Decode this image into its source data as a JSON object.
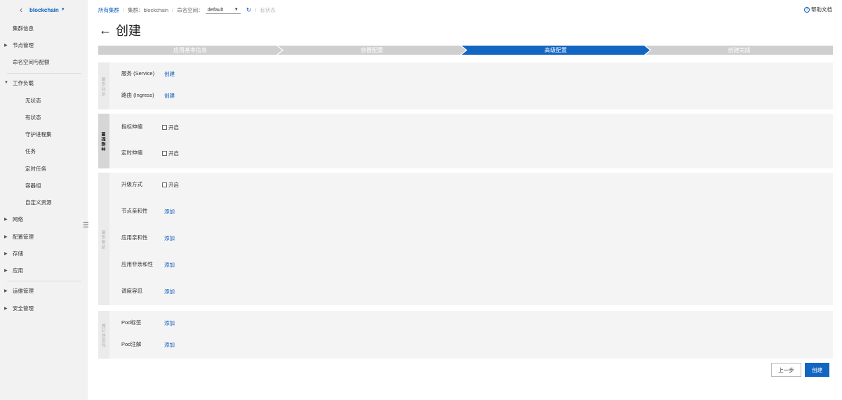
{
  "sidebar": {
    "cluster_name": "blockchain",
    "items": [
      {
        "label": "集群信息"
      },
      {
        "label": "节点管理"
      },
      {
        "label": "命名空间与配额"
      },
      {
        "label": "工作负载"
      },
      {
        "label": "无状态"
      },
      {
        "label": "有状态"
      },
      {
        "label": "守护进程集"
      },
      {
        "label": "任务"
      },
      {
        "label": "定时任务"
      },
      {
        "label": "容器组"
      },
      {
        "label": "自定义资源"
      },
      {
        "label": "网络"
      },
      {
        "label": "配置管理"
      },
      {
        "label": "存储"
      },
      {
        "label": "应用"
      },
      {
        "label": "运维管理"
      },
      {
        "label": "安全管理"
      }
    ]
  },
  "breadcrumb": {
    "all_clusters": "所有集群",
    "cluster": "集群：blockchain",
    "namespace_label": "命名空间：",
    "namespace_value": "default",
    "stateful": "有状态"
  },
  "help": "帮助文档",
  "page_title": "创建",
  "steps": [
    "应用基本信息",
    "容器配置",
    "高级配置",
    "创建完成"
  ],
  "sections": {
    "access": {
      "title": "访问设置",
      "service_label": "服务 (Service)",
      "service_action": "创建",
      "ingress_label": "路由 (Ingress)",
      "ingress_action": "创建"
    },
    "scaling": {
      "title": "伸缩配置",
      "metric_label": "指标伸缩",
      "metric_check": "开启",
      "cron_label": "定时伸缩",
      "cron_check": "开启"
    },
    "scheduling": {
      "title": "调度设置",
      "upgrade_label": "升级方式",
      "upgrade_check": "开启",
      "node_affinity_label": "节点亲和性",
      "node_affinity_action": "添加",
      "app_affinity_label": "应用亲和性",
      "app_affinity_action": "添加",
      "app_anti_affinity_label": "应用非亲和性",
      "app_anti_affinity_action": "添加",
      "tolerations_label": "调度容忍",
      "tolerations_action": "添加"
    },
    "labels": {
      "title": "标签和注解",
      "pod_labels_label": "Pod标签",
      "pod_labels_action": "添加",
      "pod_annotations_label": "Pod注解",
      "pod_annotations_action": "添加"
    }
  },
  "buttons": {
    "prev": "上一步",
    "create": "创建"
  },
  "colors": {
    "primary": "#1365c2",
    "link": "#0a5dbd",
    "step_inactive": "#cfcfcf",
    "section_bg": "#f4f4f4"
  }
}
